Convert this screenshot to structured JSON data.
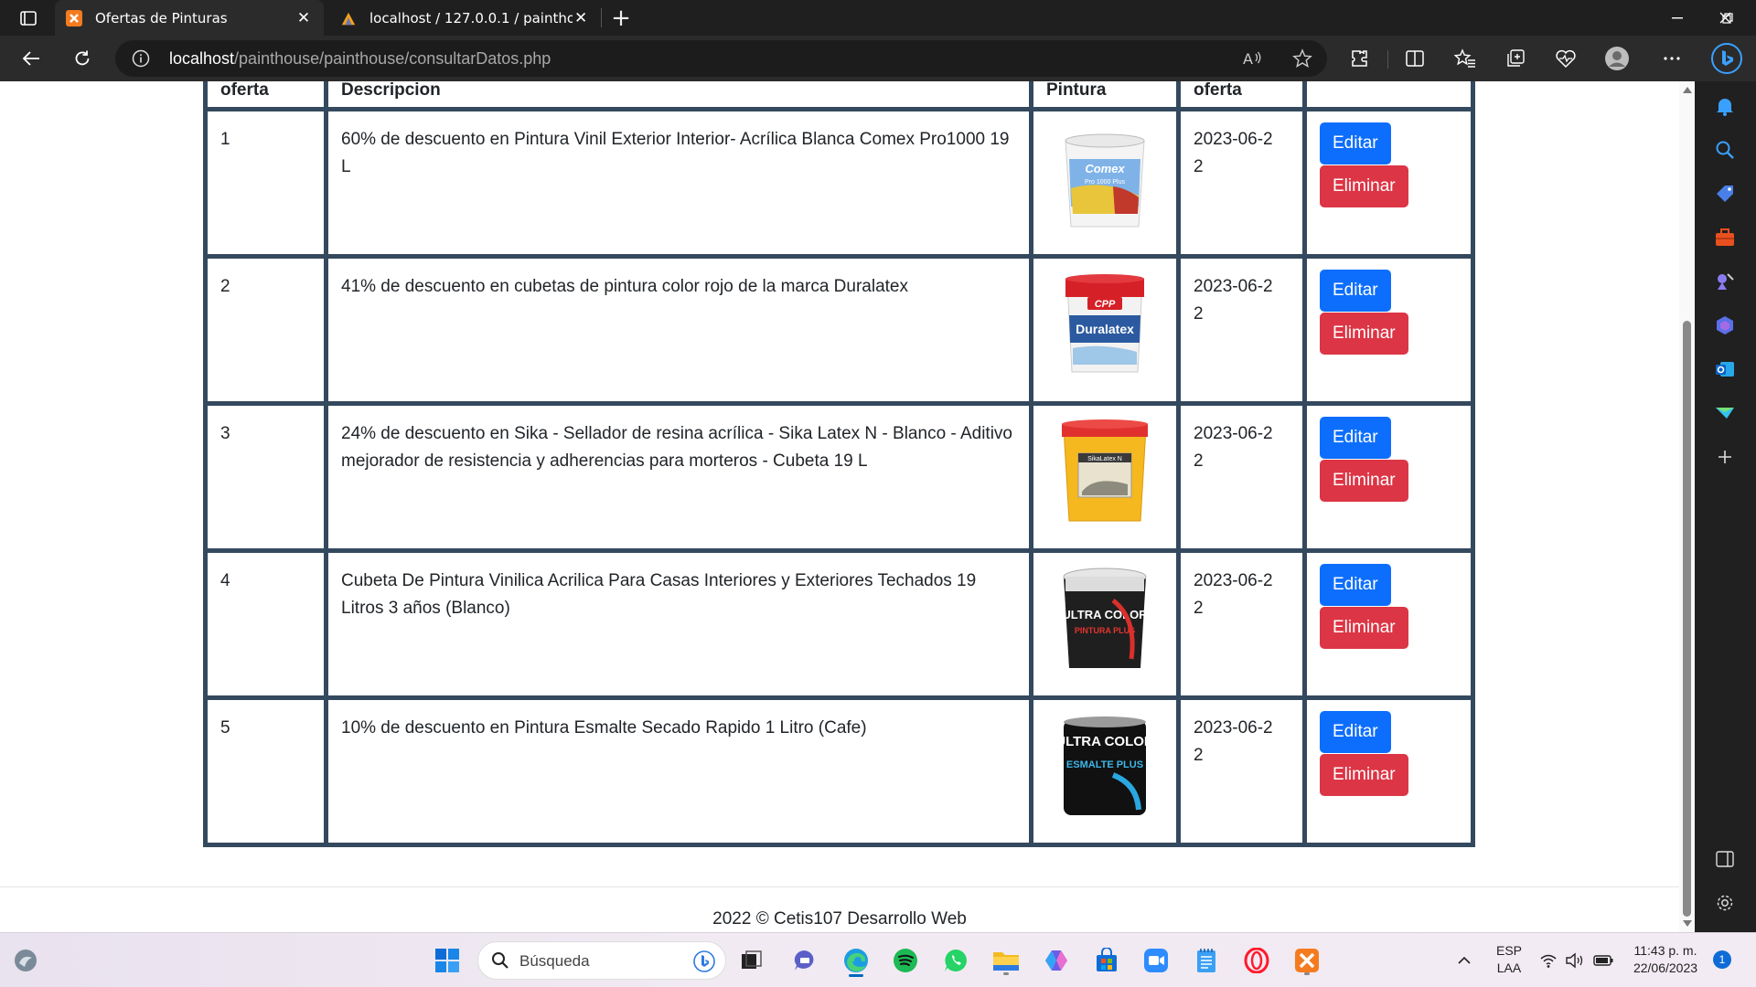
{
  "browser": {
    "tabs": [
      {
        "title": "Ofertas de Pinturas",
        "active": true,
        "favicon": "xampp-icon"
      },
      {
        "title": "localhost / 127.0.0.1 / painthouse",
        "active": false,
        "favicon": "phpmyadmin-icon"
      }
    ],
    "address": {
      "host": "localhost",
      "path": "/painthouse/painthouse/consultarDatos.php"
    }
  },
  "table": {
    "headers": [
      "oferta",
      "Descripcion",
      "Pintura",
      "oferta",
      ""
    ],
    "rows": [
      {
        "id": "1",
        "descripcion": "60% de descuento en Pintura Vinil Exterior Interior- Acrílica Blanca Comex Pro1000 19 L",
        "image_brand": "Comex",
        "image_sub": "Pro 1000 Plus",
        "fecha": "2023-06-22",
        "edit_label": "Editar",
        "delete_label": "Eliminar"
      },
      {
        "id": "2",
        "descripcion": "41% de descuento en cubetas de pintura color rojo de la marca Duralatex",
        "image_brand": "Duralatex",
        "image_sub": "CPP",
        "fecha": "2023-06-22",
        "edit_label": "Editar",
        "delete_label": "Eliminar"
      },
      {
        "id": "3",
        "descripcion": "24% de descuento en Sika - Sellador de resina acrílica - Sika Latex N - Blanco - Aditivo mejorador de resistencia y adherencias para morteros - Cubeta 19 L",
        "image_brand": "SikaLatex N",
        "image_sub": "",
        "fecha": "2023-06-22",
        "edit_label": "Editar",
        "delete_label": "Eliminar"
      },
      {
        "id": "4",
        "descripcion": "Cubeta De Pintura Vinilica Acrilica Para Casas Interiores y Exteriores Techados 19 Litros 3 años (Blanco)",
        "image_brand": "ULTRA COLOR",
        "image_sub": "PINTURA PLUS",
        "fecha": "2023-06-22",
        "edit_label": "Editar",
        "delete_label": "Eliminar"
      },
      {
        "id": "5",
        "descripcion": "10% de descuento en Pintura Esmalte Secado Rapido 1 Litro (Cafe)",
        "image_brand": "ULTRA COLOR",
        "image_sub": "ESMALTE PLUS",
        "fecha": "2023-06-22",
        "edit_label": "Editar",
        "delete_label": "Eliminar"
      }
    ]
  },
  "footer": {
    "text": "2022 © Cetis107 Desarrollo Web"
  },
  "taskbar": {
    "search_placeholder": "Búsqueda",
    "lang": "ESP",
    "lang2": "LAA",
    "time": "11:43 p. m.",
    "date": "22/06/2023",
    "notification_count": "1"
  },
  "colors": {
    "table_border": "#34495e",
    "edit_button": "#0d6efd",
    "delete_button": "#dc3545",
    "chrome_dark": "#2b2b2b"
  }
}
